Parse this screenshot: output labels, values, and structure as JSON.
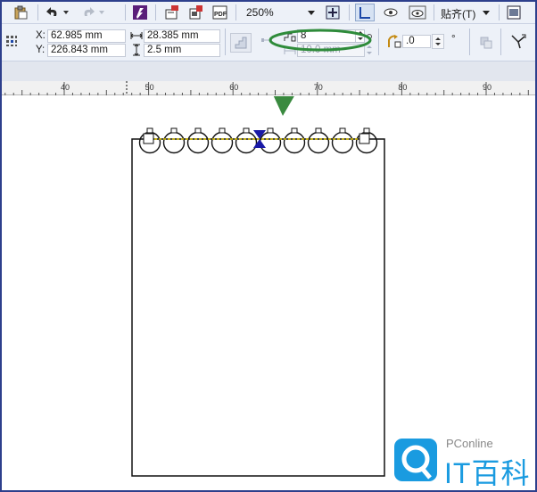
{
  "toolbar": {
    "zoom_value": "250%",
    "snap_menu_label": "贴齐(T)"
  },
  "position": {
    "x_label": "X:",
    "x_value": "62.985 mm",
    "y_label": "Y:",
    "y_value": "226.843 mm"
  },
  "size": {
    "width_value": "28.385 mm",
    "height_value": "2.5 mm"
  },
  "blend": {
    "steps_value": "8",
    "spacing_value": "10.0 mm"
  },
  "rotation": {
    "value": ".0",
    "unit": "°"
  },
  "ruler": {
    "labels": [
      "40",
      "50",
      "60",
      "70",
      "80",
      "90"
    ]
  },
  "watermark": {
    "brand_text": "PConline",
    "title_text": "IT百科"
  },
  "colors": {
    "toolbar_bg": "#edf1f8",
    "highlight_ellipse": "#2e8b3a",
    "arrow": "#3a8a3f",
    "selected_node": "#1a1aa6",
    "logo_blue": "#1a9be0"
  }
}
